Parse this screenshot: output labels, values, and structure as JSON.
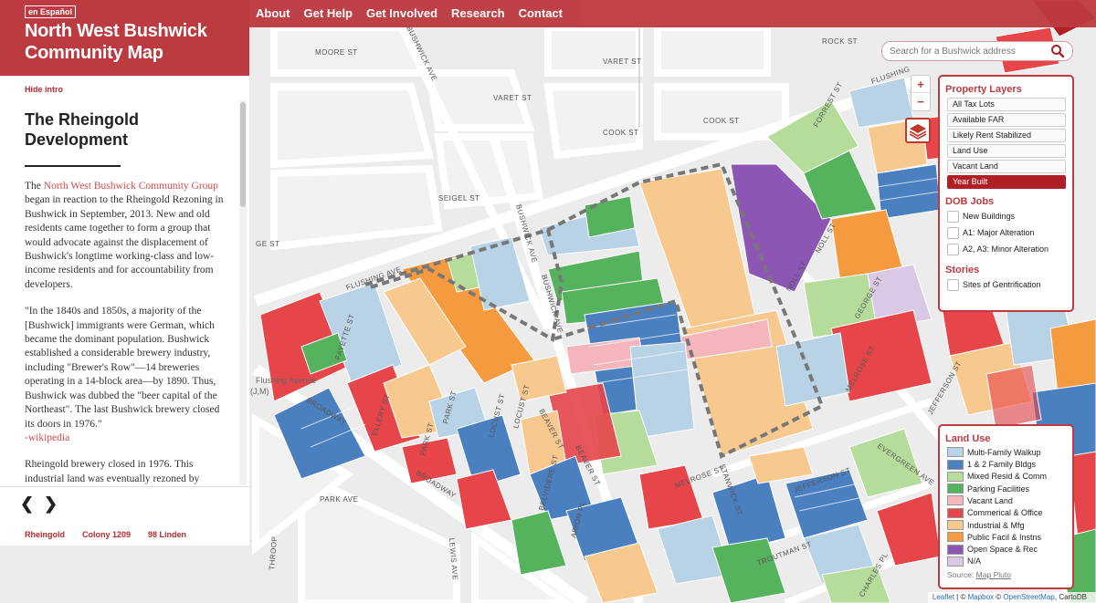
{
  "site": {
    "language_link": "en Español",
    "title": "North West Bushwick Community Map",
    "nav": [
      "About",
      "Get Help",
      "Get Involved",
      "Research",
      "Contact"
    ]
  },
  "intro": {
    "hide_label": "Hide intro",
    "heading": "The Rheingold Development",
    "p1_link": "North West Bushwick Community Group",
    "p1_text": " began in reaction to the Rheingold Rezoning in Bushwick in September, 2013. New and old residents came together to form a group that would advocate against the displacement of Bushwick's longtime working-class and low-income residents and for accountability from developers.",
    "p2_text": "\"In the 1840s and 1850s, a majority of the [Bushwick] immigrants were German, which became the dominant population. Bushwick established a considerable brewery industry, including \"Brewer's Row\"—14 breweries operating in a 14-block area—by 1890. Thus, Bushwick was dubbed the \"beer capital of the Northeast\". The last Bushwick brewery closed its doors in 1976.\"",
    "p2_link": "-wikipedia",
    "p3_text": "Rheingold brewery closed in 1976. This industrial land was eventually rezoned by",
    "prev_arrow": "❮",
    "next_arrow": "❯",
    "stories": [
      "Rheingold",
      "Colony 1209",
      "98 Linden"
    ]
  },
  "search": {
    "placeholder": "Search for a Bushwick address"
  },
  "zoom": {
    "in": "+",
    "out": "−"
  },
  "property_layers": {
    "title": "Property Layers",
    "buttons": [
      "All Tax Lots",
      "Available FAR",
      "Likely Rent Stabilized",
      "Land Use",
      "Vacant Land",
      "Year Built"
    ],
    "active": "Year Built"
  },
  "dob_jobs": {
    "title": "DOB Jobs",
    "items": [
      "New Buildings",
      "A1: Major Alteration",
      "A2, A3: Minor Alteration"
    ]
  },
  "stories_layer": {
    "title": "Stories",
    "items": [
      "Sites of Gentrification"
    ]
  },
  "land_use": {
    "title": "Land Use",
    "items": [
      {
        "label": "Multi-Family Walkup",
        "color": "#b8d2e6"
      },
      {
        "label": "1 & 2 Family Bldgs",
        "color": "#4a7fc0"
      },
      {
        "label": "Mixed Resid & Comm",
        "color": "#b5dc9a"
      },
      {
        "label": "Parking Facilities",
        "color": "#55b25d"
      },
      {
        "label": "Vacant Land",
        "color": "#f4b6ba"
      },
      {
        "label": "Commerical & Office",
        "color": "#e6454a"
      },
      {
        "label": "Industrial & Mfg",
        "color": "#f8c98f"
      },
      {
        "label": "Public Facil & Instns",
        "color": "#f59a3f"
      },
      {
        "label": "Open Space & Rec",
        "color": "#8d56b5"
      },
      {
        "label": "N/A",
        "color": "#d9c8e6"
      }
    ],
    "source_label": "Source:",
    "source_link": "Map Pluto"
  },
  "attribution": {
    "leaflet": "Leaflet",
    "sep1": " | © ",
    "mapbox": "Mapbox",
    "sep2": " © ",
    "osm": "OpenStreetMap",
    "carto": ", CartoDB"
  },
  "streets": [
    "BUSHWICK AVE",
    "MOORE ST",
    "VARET ST",
    "ROCK ST",
    "COOK ST",
    "SEIGEL ST",
    "GE ST",
    "FLUSHING AVE",
    "FORREST ST",
    "NOLL ST",
    "GEORGE ST",
    "MELROSE ST",
    "JEFFERSON ST",
    "EVERGREEN AVE",
    "TROUTMAN ST",
    "STANWICK ST",
    "CHARLES PL",
    "BEAVER ST",
    "LOCUST ST",
    "PARK ST",
    "ARION PL",
    "BELVIDERE ST",
    "LEWIS AVE",
    "BROADWAY",
    "PARK AVE",
    "FAYETTE ST",
    "ELLERY ST",
    "THROOP",
    "FLUSHING"
  ],
  "station": {
    "name": "Flushing Avenue",
    "line": "(J,M)"
  }
}
